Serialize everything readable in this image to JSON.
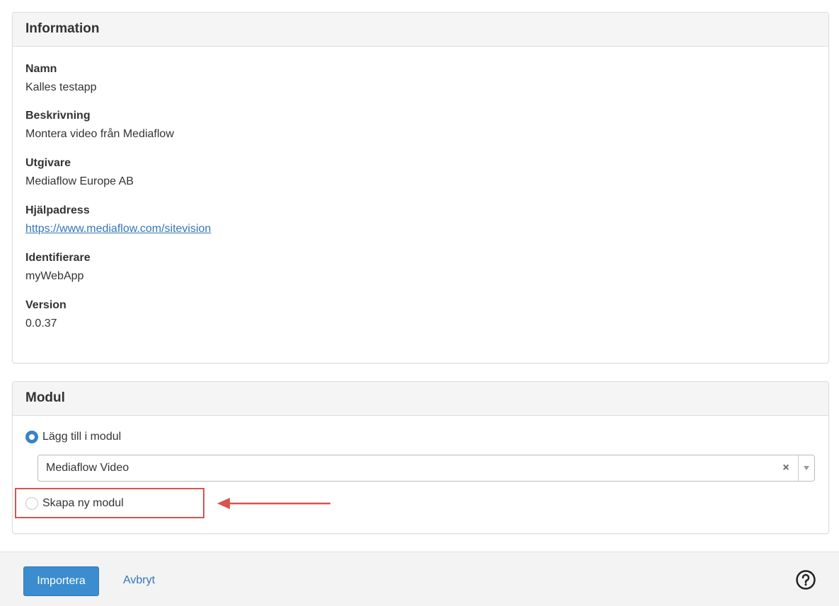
{
  "information": {
    "heading": "Information",
    "fields": [
      {
        "label": "Namn",
        "value": "Kalles testapp"
      },
      {
        "label": "Beskrivning",
        "value": "Montera video från Mediaflow"
      },
      {
        "label": "Utgivare",
        "value": "Mediaflow Europe AB"
      },
      {
        "label": "Hjälpadress",
        "value": "https://www.mediaflow.com/sitevision"
      },
      {
        "label": "Identifierare",
        "value": "myWebApp"
      },
      {
        "label": "Version",
        "value": "0.0.37"
      }
    ]
  },
  "modul": {
    "heading": "Modul",
    "option_add": {
      "label": "Lägg till i modul",
      "checked": true
    },
    "select": {
      "value": "Mediaflow Video",
      "clear": "×"
    },
    "option_new": {
      "label": "Skapa ny modul",
      "checked": false
    }
  },
  "footer": {
    "import_label": "Importera",
    "cancel_label": "Avbryt",
    "help_icon": "question-circle-icon"
  },
  "colors": {
    "accent": "#3b8dcf",
    "link": "#3576b6",
    "highlight": "#d9534f"
  }
}
